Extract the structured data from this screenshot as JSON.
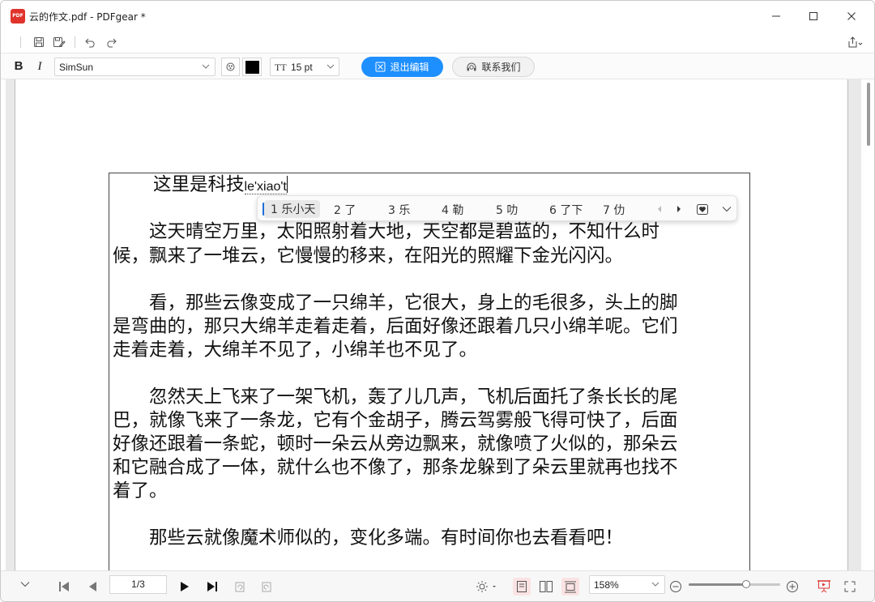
{
  "window": {
    "title": "云的作文.pdf - PDFgear *",
    "logo_text": "PDF"
  },
  "toolbar": {
    "font_family": "SimSun",
    "font_size": "15 pt",
    "font_size_icon": "TT",
    "bold_label": "B",
    "italic_label": "I",
    "text_color": "#000000",
    "exit_edit_label": "退出编辑",
    "contact_label": "联系我们",
    "accent_color": "#1e8fff"
  },
  "document": {
    "typed_prefix": "这里是科技",
    "composition": "le'xiao't",
    "lines": [
      "　　这天晴空万里，太阳照射着大地，天空都是碧蓝的，不知什么时",
      "候，飘来了一堆云，它慢慢的移来，在阳光的照耀下金光闪闪。",
      "　　看，那些云像变成了一只绵羊，它很大，身上的毛很多，头上的脚",
      "是弯曲的，那只大绵羊走着走着，后面好像还跟着几只小绵羊呢。它们",
      "走着走着，大绵羊不见了，小绵羊也不见了。",
      "　　忽然天上飞来了一架飞机，轰了儿几声，飞机后面托了条长长的尾",
      "巴，就像飞来了一条龙，它有个金胡子，腾云驾雾般飞得可快了，后面",
      "好像还跟着一条蛇，顿时一朵云从旁边飘来，就像喷了火似的，那朵云",
      "和它融合成了一体，就什么也不像了，那条龙躲到了朵云里就再也找不",
      "着了。",
      "　　那些云就像魔术师似的，变化多端。有时间你也去看看吧！"
    ]
  },
  "ime": {
    "candidates": [
      "1 乐小天",
      "2 了",
      "3 乐",
      "4 勒",
      "5 叻",
      "6 了下",
      "7 仂"
    ]
  },
  "statusbar": {
    "page_indicator": "1/3",
    "zoom": "158%",
    "zoom_level_fraction": 0.63
  }
}
